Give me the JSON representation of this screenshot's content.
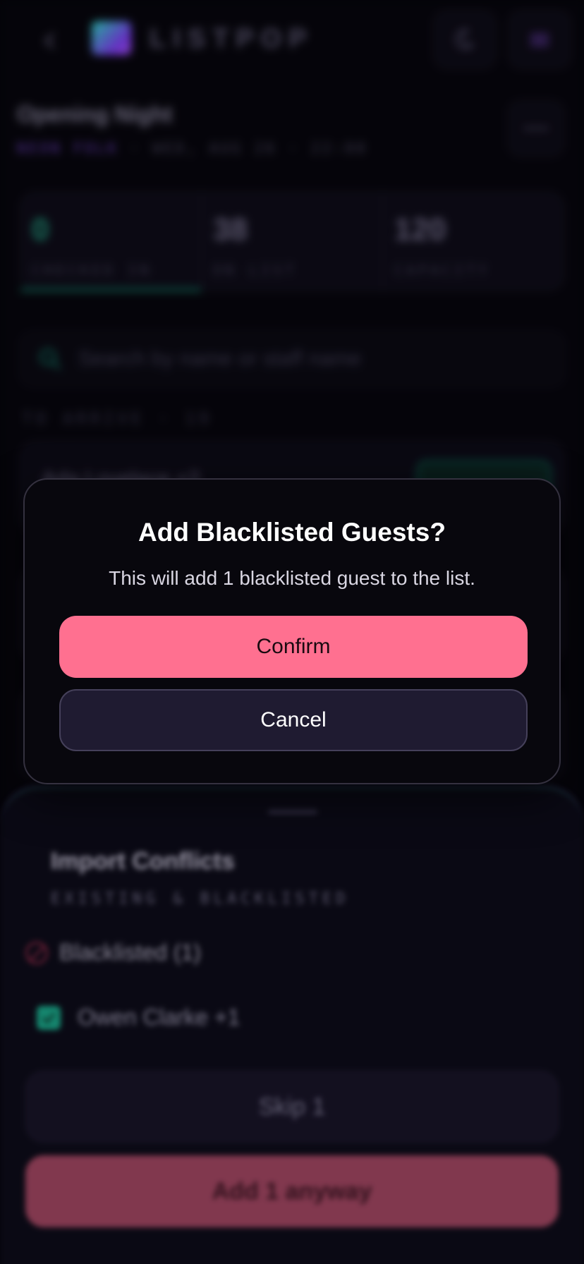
{
  "header": {
    "app_name": "LISTPOP",
    "back_icon": "back-arrow-icon",
    "theme_icon": "moon-icon",
    "menu_icon": "hamburger-menu-icon"
  },
  "event": {
    "title": "Opening Night",
    "venue": "NEON FOLK",
    "meta": "· WED, AUG 26 · 22:00",
    "more_icon": "more-icon"
  },
  "stats": [
    {
      "value": "0",
      "label": "CHECKED IN"
    },
    {
      "value": "38",
      "label": "ON LIST"
    },
    {
      "value": "120",
      "label": "CAPACITY"
    }
  ],
  "search": {
    "placeholder": "Search by name or staff name"
  },
  "section_label": "TO ARRIVE · 19",
  "guest_rows": [
    {
      "name": "Ada Lovelace +2"
    }
  ],
  "sheet": {
    "title": "Import Conflicts",
    "subtitle": "EXISTING & BLACKLISTED",
    "blacklist_heading": "Blacklisted (1)",
    "guest_name": "Owen Clarke +1",
    "skip_label": "Skip 1",
    "add_label": "Add 1 anyway"
  },
  "modal": {
    "title": "Add Blacklisted Guests?",
    "body": "This will add 1 blacklisted guest to the list.",
    "confirm_label": "Confirm",
    "cancel_label": "Cancel"
  },
  "colors": {
    "accent_pink": "#ff7090",
    "accent_green": "#1aa386",
    "modal_bg": "#08070d"
  }
}
